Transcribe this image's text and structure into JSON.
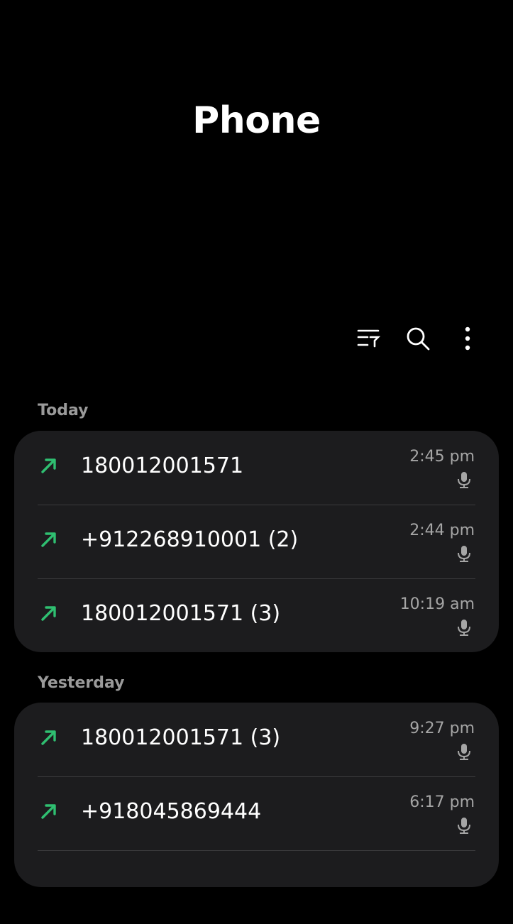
{
  "app": {
    "title": "Phone"
  },
  "toolbar": {
    "filter_icon": "filter-list-icon",
    "search_icon": "search-icon",
    "more_icon": "more-vert-icon"
  },
  "colors": {
    "outgoing_arrow": "#2fbf71",
    "card_bg": "#1c1c1e",
    "section_label": "#9a9a9a"
  },
  "sections": [
    {
      "label": "Today",
      "calls": [
        {
          "number": "180012001571",
          "time": "2:45 pm",
          "type_icon": "outgoing-call-icon",
          "recording_icon": "microphone-icon"
        },
        {
          "number": "+912268910001 (2)",
          "time": "2:44 pm",
          "type_icon": "outgoing-call-icon",
          "recording_icon": "microphone-icon"
        },
        {
          "number": "180012001571 (3)",
          "time": "10:19 am",
          "type_icon": "outgoing-call-icon",
          "recording_icon": "microphone-icon"
        }
      ]
    },
    {
      "label": "Yesterday",
      "calls": [
        {
          "number": "180012001571 (3)",
          "time": "9:27 pm",
          "type_icon": "outgoing-call-icon",
          "recording_icon": "microphone-icon"
        },
        {
          "number": "+918045869444",
          "time": "6:17 pm",
          "type_icon": "outgoing-call-icon",
          "recording_icon": "microphone-icon"
        }
      ]
    }
  ]
}
